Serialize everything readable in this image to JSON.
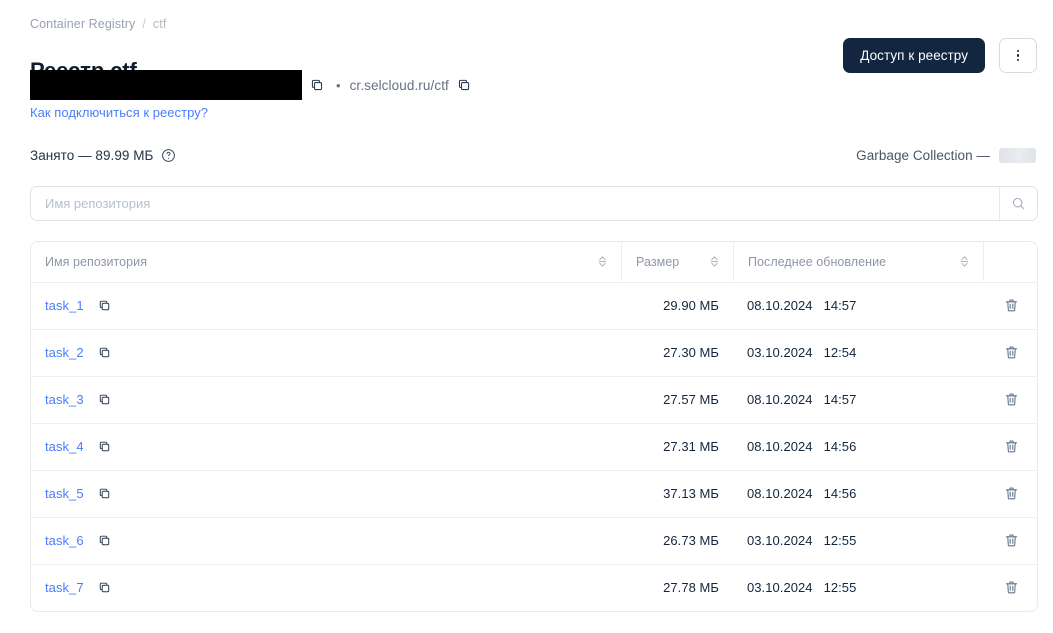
{
  "breadcrumb": {
    "root": "Container Registry",
    "separator": "/",
    "current": "ctf"
  },
  "header": {
    "title": "Реестр ctf",
    "registry_url": "cr.selcloud.ru/ctf",
    "bullet": "•",
    "help_link": "Как подключиться к реестру?",
    "access_button": "Доступ к реестру",
    "kebab_icon": "more-vertical-icon",
    "copy_icon": "copy-icon",
    "redacted_value": ""
  },
  "usage": {
    "label": "Занято — 89.99 МБ",
    "help_icon": "question-circle-icon",
    "gc_label": "Garbage Collection —",
    "gc_value": ""
  },
  "search": {
    "placeholder": "Имя репозитория",
    "value": "",
    "icon": "search-icon"
  },
  "table": {
    "columns": [
      {
        "key": "name",
        "label": "Имя репозитория",
        "sortable": true
      },
      {
        "key": "size",
        "label": "Размер",
        "sortable": true
      },
      {
        "key": "updated",
        "label": "Последнее обновление",
        "sortable": true
      },
      {
        "key": "actions",
        "label": "",
        "sortable": false
      }
    ],
    "sort_icon": "sort-arrows-icon",
    "row_copy_icon": "copy-icon",
    "row_delete_icon": "trash-icon",
    "rows": [
      {
        "name": "task_1",
        "size": "29.90 МБ",
        "date": "08.10.2024",
        "time": "14:57"
      },
      {
        "name": "task_2",
        "size": "27.30 МБ",
        "date": "03.10.2024",
        "time": "12:54"
      },
      {
        "name": "task_3",
        "size": "27.57 МБ",
        "date": "08.10.2024",
        "time": "14:57"
      },
      {
        "name": "task_4",
        "size": "27.31 МБ",
        "date": "08.10.2024",
        "time": "14:56"
      },
      {
        "name": "task_5",
        "size": "37.13 МБ",
        "date": "08.10.2024",
        "time": "14:56"
      },
      {
        "name": "task_6",
        "size": "26.73 МБ",
        "date": "03.10.2024",
        "time": "12:55"
      },
      {
        "name": "task_7",
        "size": "27.78 МБ",
        "date": "03.10.2024",
        "time": "12:55"
      }
    ]
  },
  "colors": {
    "link": "#4a7dfc",
    "button_bg": "#12263f",
    "text_muted": "#98a2b3",
    "border": "#e7eaee",
    "redaction": "#000000"
  }
}
